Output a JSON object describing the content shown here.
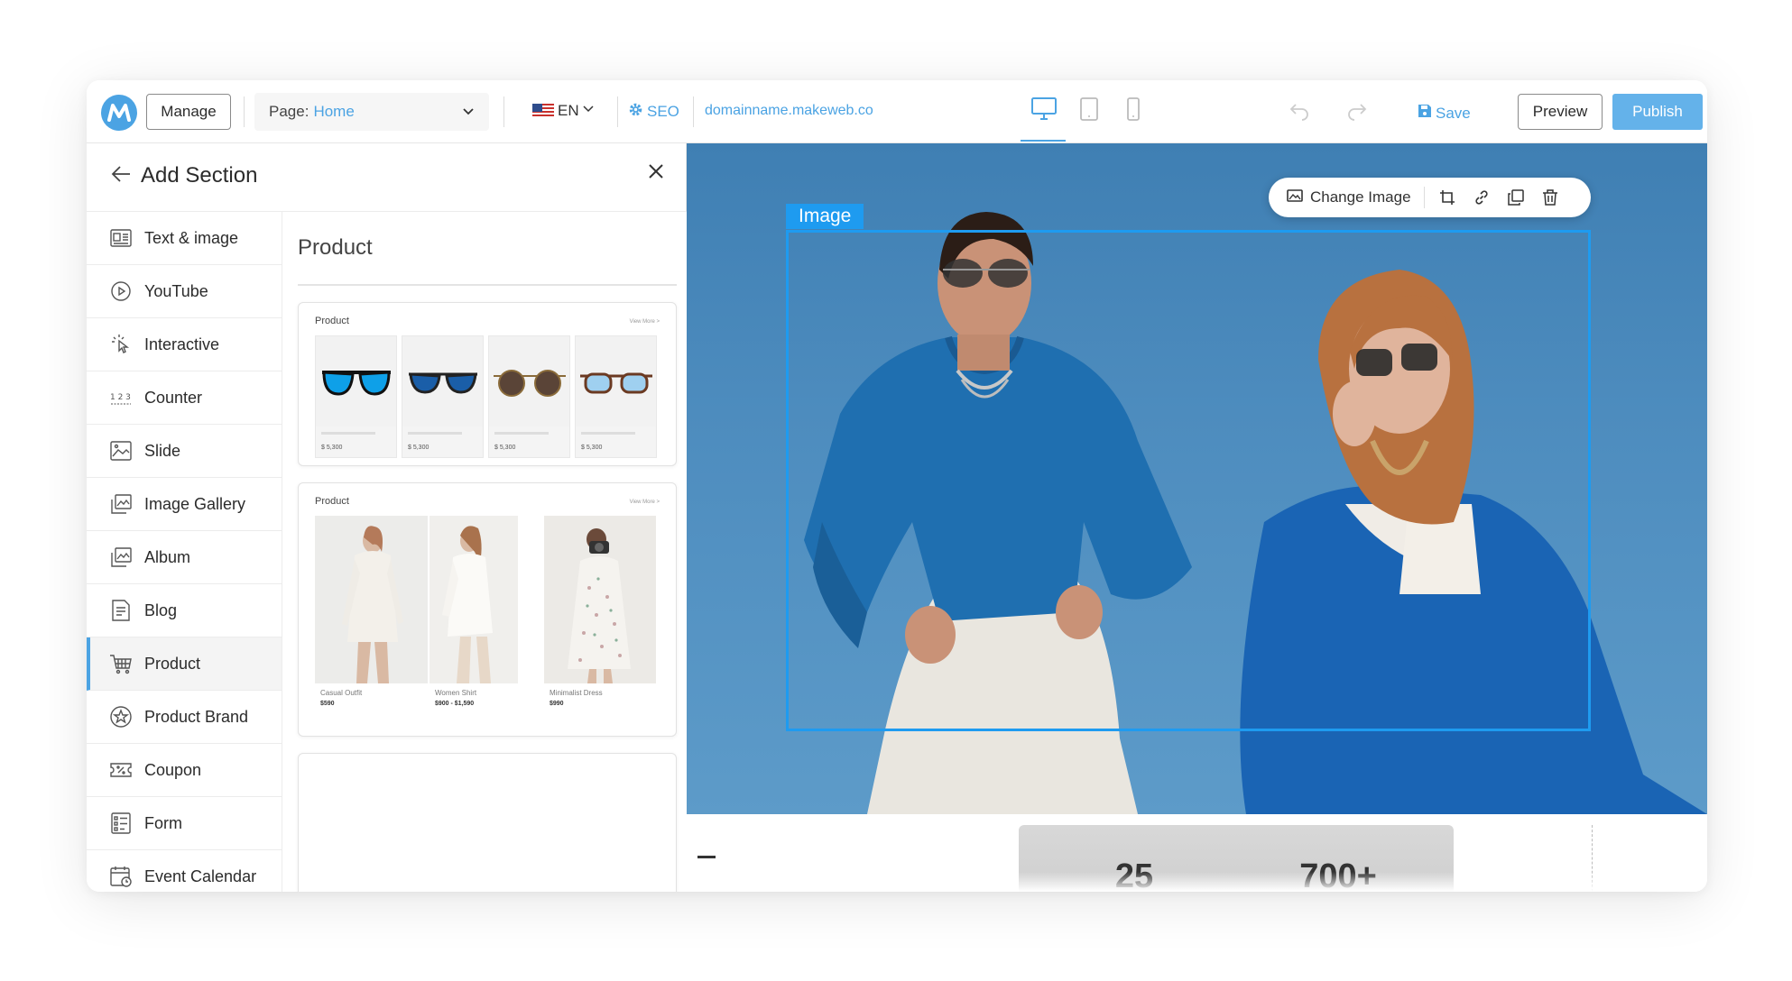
{
  "topbar": {
    "manage_label": "Manage",
    "page_prefix": "Page:",
    "page_value": "Home",
    "lang_label": "EN",
    "seo_label": "SEO",
    "domain": "domainname.makeweb.co",
    "save_label": "Save",
    "preview_label": "Preview",
    "publish_label": "Publish",
    "active_device": "desktop"
  },
  "panel": {
    "title": "Add Section",
    "categories": [
      {
        "label": "Text & image",
        "icon": "text-image-icon"
      },
      {
        "label": "YouTube",
        "icon": "play-icon"
      },
      {
        "label": "Interactive",
        "icon": "pointer-click-icon"
      },
      {
        "label": "Counter",
        "icon": "counter-icon"
      },
      {
        "label": "Slide",
        "icon": "slide-icon"
      },
      {
        "label": "Image Gallery",
        "icon": "gallery-icon"
      },
      {
        "label": "Album",
        "icon": "album-icon"
      },
      {
        "label": "Blog",
        "icon": "blog-icon"
      },
      {
        "label": "Product",
        "icon": "cart-icon",
        "active": true
      },
      {
        "label": "Product Brand",
        "icon": "brand-star-icon"
      },
      {
        "label": "Coupon",
        "icon": "coupon-icon"
      },
      {
        "label": "Form",
        "icon": "form-icon"
      },
      {
        "label": "Event Calendar",
        "icon": "calendar-icon"
      }
    ],
    "section_title": "Product",
    "templates": [
      {
        "title": "Product",
        "more": "View More >",
        "items": [
          {
            "price": "$ 5,300"
          },
          {
            "price": "$ 5,300"
          },
          {
            "price": "$ 5,300"
          },
          {
            "price": "$ 5,300"
          }
        ]
      },
      {
        "title": "Product",
        "more": "View More >",
        "items": [
          {
            "name": "Casual Outfit",
            "price": "$590"
          },
          {
            "name": "Women Shirt",
            "price": "$900 - $1,590"
          },
          {
            "name": "Minimalist Dress",
            "price": "$990"
          }
        ]
      }
    ]
  },
  "canvas": {
    "selection_label": "Image",
    "toolbar": {
      "change_image_label": "Change Image"
    },
    "stats": [
      "25",
      "700+"
    ]
  },
  "colors": {
    "accent": "#4ba3e3",
    "selection": "#1e9bf0",
    "publish_bg": "#64b2ea",
    "hero_sky": "#4d8cbe"
  }
}
